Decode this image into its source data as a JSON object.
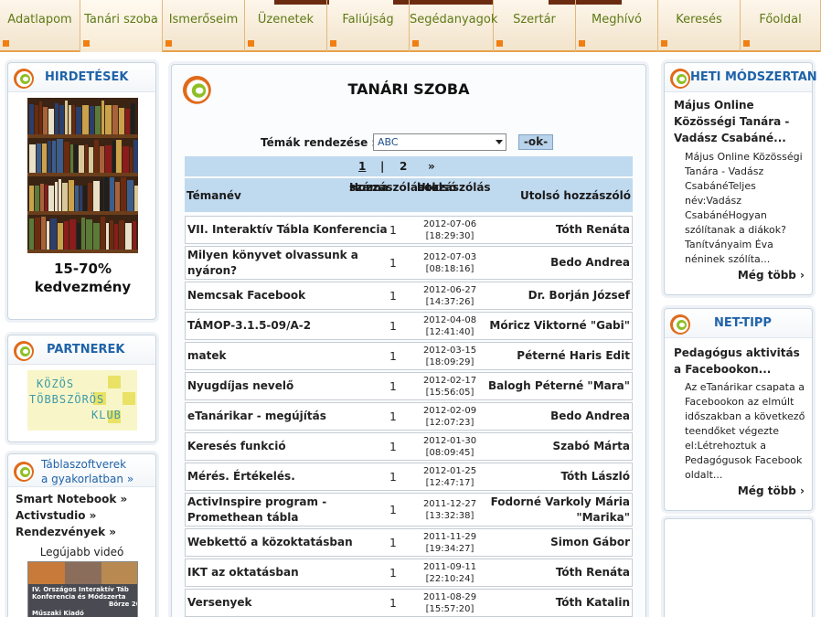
{
  "nav": {
    "items": [
      {
        "label": "Adatlapom"
      },
      {
        "label": "Tanári szoba"
      },
      {
        "label": "Ismerőseim"
      },
      {
        "label": "Üzenetek"
      },
      {
        "label": "Faliújság"
      },
      {
        "label": "Segédanyagok"
      },
      {
        "label": "Szertár"
      },
      {
        "label": "Meghívó"
      },
      {
        "label": "Keresés"
      },
      {
        "label": "Főoldal"
      }
    ],
    "active_index": 1,
    "accent_color": "#f07f12",
    "label_color": "#5e7a16"
  },
  "left": {
    "ads": {
      "title": "HIRDETÉSEK",
      "discount_line1": "15-70%",
      "discount_line2": "kedvezmény"
    },
    "partners": {
      "title": "PARTNEREK",
      "logo_line1": "KÖZÖS",
      "logo_line2": "TÖBBSZÖRÖS",
      "logo_line3": "KLUB"
    },
    "tables": {
      "title_line1": "Táblaszoftverek",
      "title_line2": "a gyakorlatban »",
      "links": [
        {
          "label": "Smart Notebook »"
        },
        {
          "label": "Activstudio »"
        },
        {
          "label": "Rendezvények »"
        }
      ],
      "newest_video": "Legújabb videó",
      "video_caption_1": "IV. Országos Interaktív Táb",
      "video_caption_2": "Konferencia és Módszerta",
      "video_caption_3": "Börze 20",
      "video_caption_4": "Műszaki Kiadó"
    }
  },
  "center": {
    "title": "TANÁRI SZOBA",
    "sort_label": "Témák rendezése :",
    "sort_value": "ABC",
    "ok_label": "-ok-",
    "pager": {
      "page1": "1",
      "sep": "|",
      "page2": "2",
      "next": "»"
    },
    "columns": {
      "topic": "Témanév",
      "count_1": "Hozzászólások",
      "count_2": "száma",
      "last_1": "Utolsó",
      "last_2": "hozzászólás",
      "author": "Utolsó hozzászóló"
    },
    "rows": [
      {
        "topic_1": "VII. Interaktív Tábla Konferencia",
        "topic_2": "",
        "count": "1",
        "date": "2012-07-06",
        "time": "[18:29:30]",
        "author_1": "Tóth Renáta",
        "author_2": ""
      },
      {
        "topic_1": "Milyen könyvet olvassunk a",
        "topic_2": "nyáron?",
        "count": "1",
        "date": "2012-07-03",
        "time": "[08:18:16]",
        "author_1": "Bedo Andrea",
        "author_2": ""
      },
      {
        "topic_1": "Nemcsak Facebook",
        "topic_2": "",
        "count": "1",
        "date": "2012-06-27",
        "time": "[14:37:26]",
        "author_1": "Dr. Borján József",
        "author_2": ""
      },
      {
        "topic_1": "TÁMOP-3.1.5-09/A-2",
        "topic_2": "",
        "count": "1",
        "date": "2012-04-08",
        "time": "[12:41:40]",
        "author_1": "Móricz Viktorné \"Gabi\"",
        "author_2": ""
      },
      {
        "topic_1": "matek",
        "topic_2": "",
        "count": "1",
        "date": "2012-03-15",
        "time": "[18:09:29]",
        "author_1": "Péterné Haris Edit",
        "author_2": ""
      },
      {
        "topic_1": "Nyugdíjas nevelő",
        "topic_2": "",
        "count": "1",
        "date": "2012-02-17",
        "time": "[15:56:05]",
        "author_1": "Balogh Péterné \"Mara\"",
        "author_2": ""
      },
      {
        "topic_1": "eTanárikar - megújítás",
        "topic_2": "",
        "count": "1",
        "date": "2012-02-09",
        "time": "[12:07:23]",
        "author_1": "Bedo Andrea",
        "author_2": ""
      },
      {
        "topic_1": "Keresés funkció",
        "topic_2": "",
        "count": "1",
        "date": "2012-01-30",
        "time": "[08:09:45]",
        "author_1": "Szabó Márta",
        "author_2": ""
      },
      {
        "topic_1": "Mérés. Értékelés.",
        "topic_2": "",
        "count": "1",
        "date": "2012-01-25",
        "time": "[12:47:17]",
        "author_1": "Tóth László",
        "author_2": ""
      },
      {
        "topic_1": "ActivInspire program -",
        "topic_2": "Promethean tábla",
        "count": "1",
        "date": "2011-12-27",
        "time": "[13:32:38]",
        "author_1": "Fodorné Varkoly Mária",
        "author_2": "\"Marika\""
      },
      {
        "topic_1": "Webkettő a közoktatásban",
        "topic_2": "",
        "count": "1",
        "date": "2011-11-29",
        "time": "[19:34:27]",
        "author_1": "Simon Gábor",
        "author_2": ""
      },
      {
        "topic_1": "IKT az oktatásban",
        "topic_2": "",
        "count": "1",
        "date": "2011-09-11",
        "time": "[22:10:24]",
        "author_1": "Tóth Renáta",
        "author_2": ""
      },
      {
        "topic_1": "Versenyek",
        "topic_2": "",
        "count": "1",
        "date": "2011-08-29",
        "time": "[15:57:20]",
        "author_1": "Tóth Katalin",
        "author_2": ""
      }
    ]
  },
  "right": {
    "method": {
      "title": "HETI MÓDSZERTAN",
      "headline": "Május Online Közösségi Tanára - Vadász Csabáné...",
      "body": "Május Online Közösségi Tanára - Vadász CsabánéTeljes név:Vadász CsabánéHogyan szólítanak a diákok? Tanítványaim Éva néninek szólíta...",
      "more": "Még több ›"
    },
    "nettip": {
      "title": "NET-TIPP",
      "headline": "Pedagógus aktivitás a Facebookon...",
      "body": "Az eTanárikar csapata a Facebookon az elmúlt időszakban a következő teendőket végezte el:Létrehoztuk a Pedagógusok Facebook oldalt...",
      "more": "Még több ›"
    }
  },
  "colors": {
    "heading_blue": "#1f63a8",
    "table_header_bg": "#bfd9ef",
    "orange": "#f07f12"
  }
}
